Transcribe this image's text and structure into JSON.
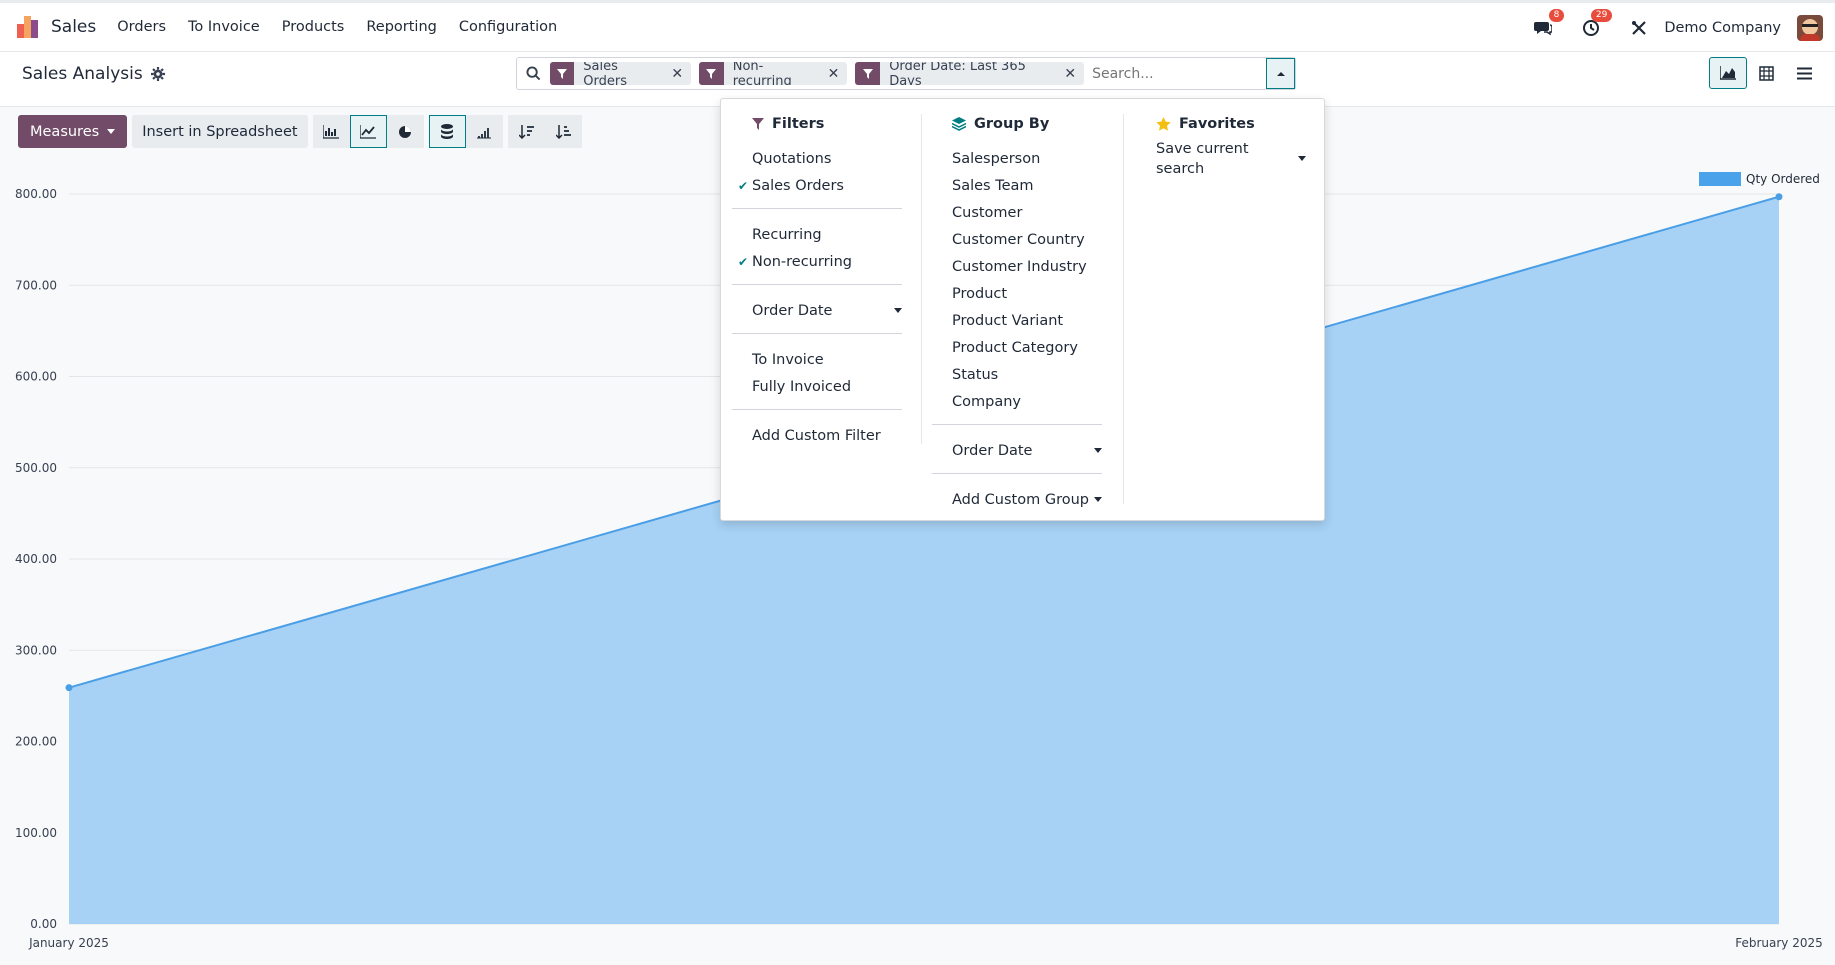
{
  "app": {
    "name": "Sales"
  },
  "nav": {
    "items": [
      "Orders",
      "To Invoice",
      "Products",
      "Reporting",
      "Configuration"
    ]
  },
  "topright": {
    "messages_count": "8",
    "activities_count": "29",
    "company": "Demo Company"
  },
  "breadcrumb": {
    "title": "Sales Analysis"
  },
  "search": {
    "facets": [
      "Sales Orders",
      "Non-recurring",
      "Order Date: Last 365 Days"
    ],
    "placeholder": "Search..."
  },
  "toolbar": {
    "measures_label": "Measures",
    "insert_label": "Insert in Spreadsheet"
  },
  "filters": {
    "heading": "Filters",
    "groups": [
      [
        {
          "label": "Quotations",
          "checked": false
        },
        {
          "label": "Sales Orders",
          "checked": true
        }
      ],
      [
        {
          "label": "Recurring",
          "checked": false
        },
        {
          "label": "Non-recurring",
          "checked": true
        }
      ],
      [
        {
          "label": "Order Date",
          "dropdown": true
        }
      ],
      [
        {
          "label": "To Invoice",
          "checked": false
        },
        {
          "label": "Fully Invoiced",
          "checked": false
        }
      ],
      [
        {
          "label": "Add Custom Filter"
        }
      ]
    ]
  },
  "groupby": {
    "heading": "Group By",
    "items": [
      "Salesperson",
      "Sales Team",
      "Customer",
      "Customer Country",
      "Customer Industry",
      "Product",
      "Product Variant",
      "Product Category",
      "Status",
      "Company"
    ],
    "order_date": "Order Date",
    "custom": "Add Custom Group"
  },
  "favorites": {
    "heading": "Favorites",
    "save": "Save current search"
  },
  "colors": {
    "accent": "#714b67",
    "teal": "#017e84",
    "area": "#a7d2f5",
    "line": "#4a9ee6"
  },
  "chart_data": {
    "type": "area",
    "categories": [
      "January 2025",
      "February 2025"
    ],
    "series": [
      {
        "name": "Qty Ordered",
        "values": [
          259,
          797
        ]
      }
    ],
    "ylim": [
      0,
      800
    ],
    "yticks": [
      "0.00",
      "100.00",
      "200.00",
      "300.00",
      "400.00",
      "500.00",
      "600.00",
      "700.00",
      "800.00"
    ],
    "legend": "top-right",
    "grid": true
  }
}
